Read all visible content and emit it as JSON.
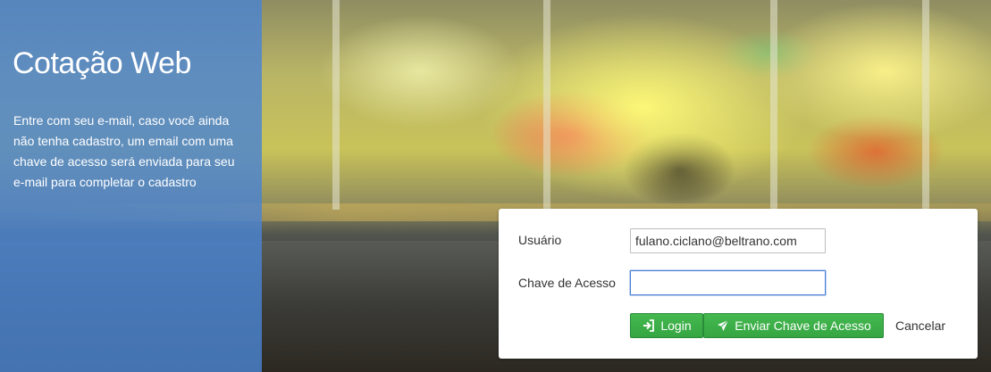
{
  "brand": {
    "title": "Cotação Web",
    "description": "Entre com seu e-mail, caso você ainda não tenha cadastro, um email com uma chave de acesso será enviada para seu e-mail para completar o cadastro",
    "panel_color": "#4a84d2"
  },
  "login_form": {
    "user_label": "Usuário",
    "user_value": "fulano.ciclano@beltrano.com",
    "key_label": "Chave de Acesso",
    "key_value": "",
    "login_button": "Login",
    "login_icon": "sign-in-icon",
    "send_key_button": "Enviar Chave de Acesso",
    "send_key_icon": "paper-plane-icon",
    "cancel_button": "Cancelar",
    "button_color": "#3cb44b",
    "focus_color": "#4a7fd8"
  }
}
